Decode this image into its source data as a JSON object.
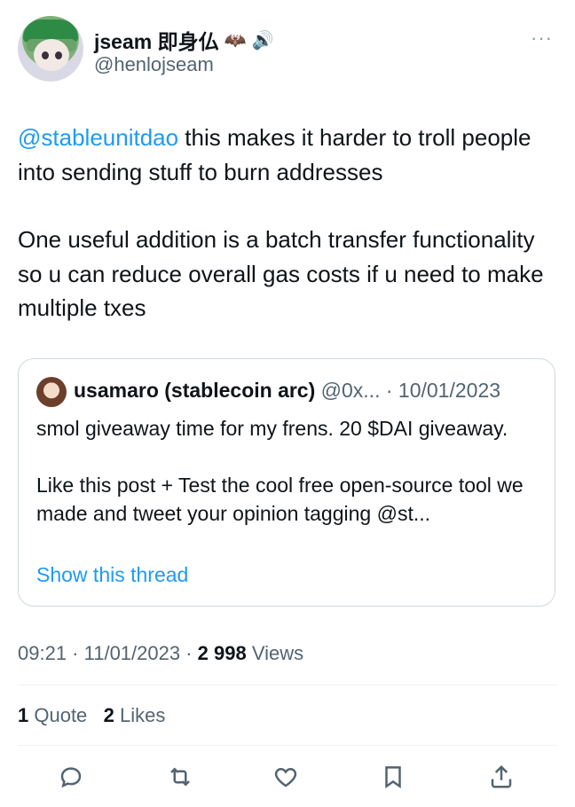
{
  "author": {
    "display_name": "jseam 即身仏",
    "badges": [
      "🦇",
      "🔊"
    ],
    "handle": "@henlojseam"
  },
  "tweet": {
    "mention": "@stableunitdao",
    "line1_rest": " this makes it harder to troll people into sending stuff to burn addresses",
    "paragraph2": "One useful addition is a batch transfer functionality so u can reduce overall gas costs if u need to make multiple txes"
  },
  "quote": {
    "name": "usamaro (stablecoin arc)",
    "handle": "@0x...",
    "separator": " · ",
    "date": "10/01/2023",
    "paragraph1": "smol giveaway time for my frens. 20 $DAI giveaway.",
    "paragraph2": "Like this post + Test the cool free open-source tool we made and tweet your opinion tagging @st...",
    "show_thread": "Show this thread"
  },
  "meta": {
    "time": "09:21",
    "dot1": " · ",
    "date": "11/01/2023",
    "dot2": " · ",
    "views_count": "2 998",
    "views_label": " Views"
  },
  "stats": {
    "quotes_count": "1",
    "quotes_label": " Quote",
    "likes_count": "2",
    "likes_label": " Likes"
  },
  "more_label": "···",
  "icons": {
    "reply": "reply-icon",
    "retweet": "retweet-icon",
    "like": "heart-icon",
    "bookmark": "bookmark-icon",
    "share": "share-icon"
  },
  "colors": {
    "link": "#1d9bf0",
    "secondary": "#536471",
    "text": "#0f1419",
    "border": "#cfd9de"
  }
}
